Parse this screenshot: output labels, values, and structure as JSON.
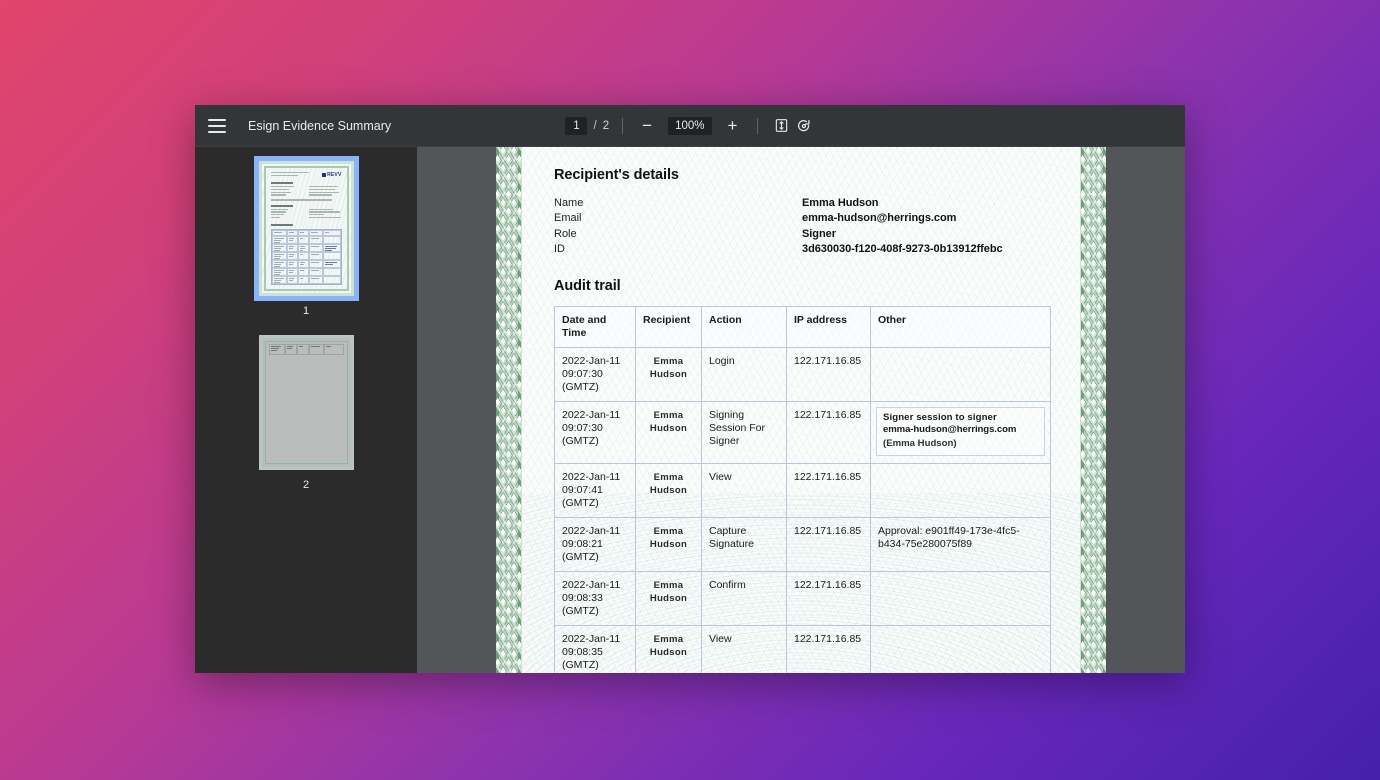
{
  "toolbar": {
    "menu_icon": "hamburger-menu-icon",
    "title": "Esign Evidence Summary",
    "current_page": "1",
    "page_separator": "/",
    "total_pages": "2",
    "zoom_out_label": "−",
    "zoom_level": "100%",
    "zoom_in_label": "+",
    "fit_page_icon": "fit-to-page-icon",
    "rotate_icon": "rotate-icon"
  },
  "thumbnails": [
    {
      "label": "1",
      "selected": true
    },
    {
      "label": "2",
      "selected": false
    }
  ],
  "document": {
    "logo_text": "REVV",
    "recipient_section_title": "Recipient's details",
    "recipient_fields": [
      {
        "key": "Name",
        "value": "Emma Hudson"
      },
      {
        "key": "Email",
        "value": "emma-hudson@herrings.com"
      },
      {
        "key": "Role",
        "value": "Signer"
      },
      {
        "key": "ID",
        "value": "3d630030-f120-408f-9273-0b13912ffebc"
      }
    ],
    "audit_section_title": "Audit trail",
    "audit_columns": [
      "Date and Time",
      "Recipient",
      "Action",
      "IP address",
      "Other"
    ],
    "audit_rows": [
      {
        "date": "2022-Jan-11 09:07:30 (GMTZ)",
        "recipient": "Emma Hudson",
        "action": "Login",
        "ip": "122.171.16.85",
        "other_type": "empty",
        "other": ""
      },
      {
        "date": "2022-Jan-11 09:07:30 (GMTZ)",
        "recipient": "Emma Hudson",
        "action": "Signing Session For Signer",
        "ip": "122.171.16.85",
        "other_type": "box",
        "other_line1": "Signer session  to signer",
        "other_line2": "emma-hudson@herrings.com",
        "other_line3": "(Emma Hudson)"
      },
      {
        "date": "2022-Jan-11 09:07:41 (GMTZ)",
        "recipient": "Emma Hudson",
        "action": "View",
        "ip": "122.171.16.85",
        "other_type": "empty",
        "other": ""
      },
      {
        "date": "2022-Jan-11 09:08:21 (GMTZ)",
        "recipient": "Emma Hudson",
        "action": "Capture Signature",
        "ip": "122.171.16.85",
        "other_type": "plain",
        "other": "Approval: e901ff49-173e-4fc5-b434-75e280075f89"
      },
      {
        "date": "2022-Jan-11 09:08:33 (GMTZ)",
        "recipient": "Emma Hudson",
        "action": "Confirm",
        "ip": "122.171.16.85",
        "other_type": "empty",
        "other": ""
      },
      {
        "date": "2022-Jan-11 09:08:35 (GMTZ)",
        "recipient": "Emma Hudson",
        "action": "View",
        "ip": "122.171.16.85",
        "other_type": "empty",
        "other": ""
      }
    ]
  },
  "colors": {
    "toolbar_bg": "#323639",
    "sidebar_bg": "#2b2b2b",
    "stage_bg": "#525659",
    "thumb_selected": "#8ab4f8",
    "page_bg": "#fbfdfc",
    "border_green": "#6f9e79",
    "table_border": "#b9c7d8",
    "gradient_start": "#e0456b",
    "gradient_end": "#4520ab"
  }
}
